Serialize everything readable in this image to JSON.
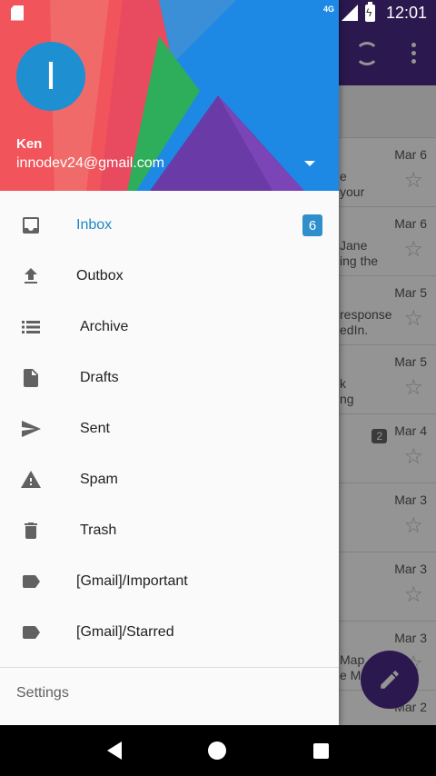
{
  "status": {
    "network": "4G",
    "time": "12:01"
  },
  "account": {
    "initial": "I",
    "name": "Ken",
    "email": "innodev24@gmail.com"
  },
  "nav": [
    {
      "label": "Inbox",
      "icon": "inbox-icon",
      "badge": "6",
      "active": true
    },
    {
      "label": "Outbox",
      "icon": "outbox-icon"
    },
    {
      "label": "Archive",
      "icon": "archive-icon"
    },
    {
      "label": "Drafts",
      "icon": "drafts-icon"
    },
    {
      "label": "Sent",
      "icon": "send-icon"
    },
    {
      "label": "Spam",
      "icon": "spam-icon"
    },
    {
      "label": "Trash",
      "icon": "trash-icon"
    },
    {
      "label": "[Gmail]/Important",
      "icon": "label-icon"
    },
    {
      "label": "[Gmail]/Starred",
      "icon": "label-icon"
    }
  ],
  "settings_label": "Settings",
  "mail_list": [
    {
      "date": "Mar 6",
      "snippet": "e\nyour"
    },
    {
      "date": "Mar 6",
      "snippet": "Jane\ning the"
    },
    {
      "date": "Mar 5",
      "snippet": "response\nedIn."
    },
    {
      "date": "Mar 5",
      "snippet": "k\nng"
    },
    {
      "date": "Mar 4",
      "snippet": "",
      "badge": "2"
    },
    {
      "date": "Mar 3",
      "snippet": ""
    },
    {
      "date": "Mar 3",
      "snippet": ""
    },
    {
      "date": "Mar 3",
      "snippet": "Map\ne Ma"
    },
    {
      "date": "Mar 2",
      "snippet": ""
    }
  ],
  "colors": {
    "accent": "#1e88c8",
    "appbar": "#4a2a88",
    "badge": "#2e8fcb"
  }
}
